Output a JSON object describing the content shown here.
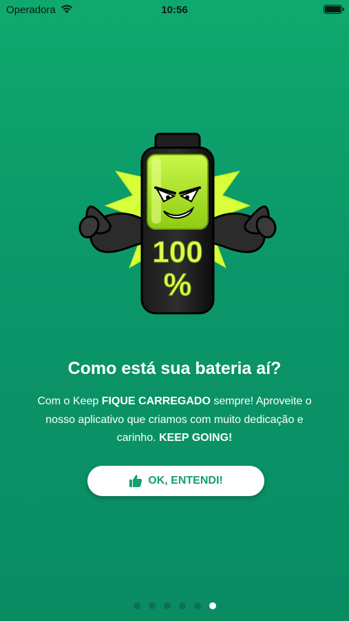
{
  "status": {
    "carrier": "Operadora",
    "time": "10:56",
    "wifi_icon": "wifi-icon",
    "battery_icon": "battery-icon"
  },
  "hero": {
    "icon": "strong-battery-mascot-icon",
    "percent_line1": "100",
    "percent_line2": "%"
  },
  "content": {
    "title": "Como está sua bateria aí?",
    "desc_1": "Com o Keep ",
    "desc_bold_1": "FIQUE CARREGADO",
    "desc_2": " sempre! Aproveite o nosso aplicativo que criamos com muito dedicação e carinho. ",
    "desc_bold_2": "KEEP GOING!"
  },
  "cta": {
    "label": "OK, ENTENDI!",
    "icon": "thumbs-up-icon"
  },
  "pagination": {
    "total": 6,
    "current": 6
  },
  "colors": {
    "background": "#0b9669",
    "accent": "#13a06a",
    "battery_green": "#a6e31b"
  }
}
